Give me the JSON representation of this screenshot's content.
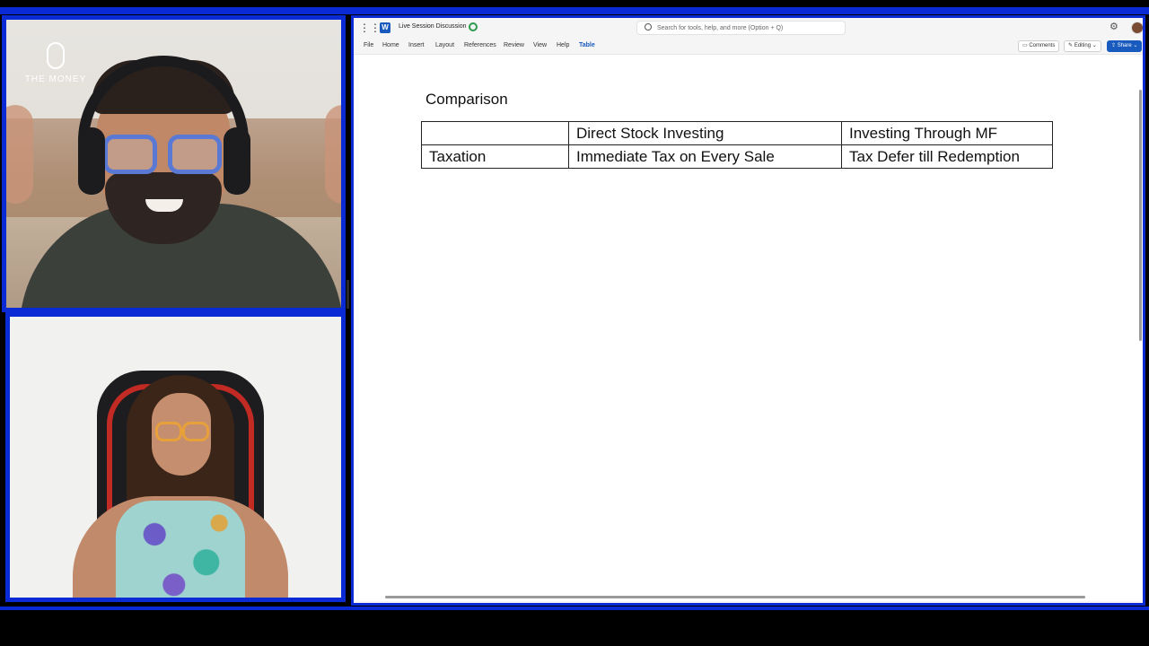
{
  "colors": {
    "frame_blue": "#0a2ad6",
    "word_blue": "#185abd",
    "background": "#000000"
  },
  "branding": {
    "logo_text": "THE MONEY",
    "logo_icon": "microphone-icon"
  },
  "word": {
    "document_title": "Live Session Discussion",
    "search_placeholder": "Search for tools, help, and more (Option + Q)",
    "menu": [
      "File",
      "Home",
      "Insert",
      "Layout",
      "References",
      "Review",
      "View",
      "Help",
      "Table"
    ],
    "active_menu": "Table",
    "comments_label": "Comments",
    "editing_label": "Editing",
    "share_label": "Share",
    "icons": [
      "app-launcher-icon",
      "word-icon",
      "sync-icon",
      "search-icon",
      "gear-icon",
      "avatar"
    ]
  },
  "document": {
    "heading": "Comparison",
    "table": {
      "header": [
        "",
        "Direct Stock Investing",
        "Investing Through MF"
      ],
      "rows": [
        [
          "Taxation",
          "Immediate Tax on Every Sale",
          "Tax Defer till Redemption"
        ]
      ]
    }
  }
}
